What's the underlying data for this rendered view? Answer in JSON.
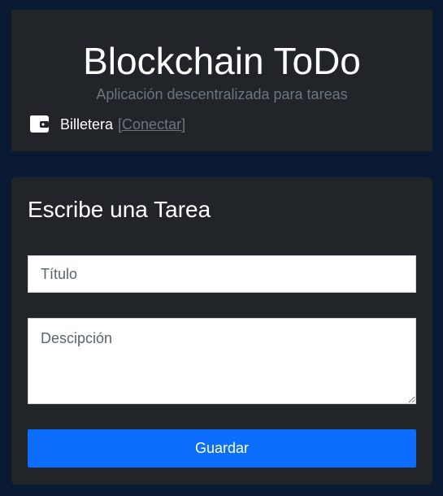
{
  "header": {
    "title": "Blockchain ToDo",
    "subtitle": "Aplicación descentralizada para tareas",
    "wallet": {
      "icon": "wallet-icon",
      "label": "Billetera",
      "connect_link": "[Conectar]"
    }
  },
  "form": {
    "title": "Escribe una Tarea",
    "title_field": {
      "placeholder": "Título",
      "value": ""
    },
    "description_field": {
      "placeholder": "Descipción",
      "value": ""
    },
    "save_label": "Guardar"
  },
  "colors": {
    "page_background": "#0b1a33",
    "card_background": "#212529",
    "muted_text": "#6c757d",
    "primary_button": "#0d6efd"
  }
}
